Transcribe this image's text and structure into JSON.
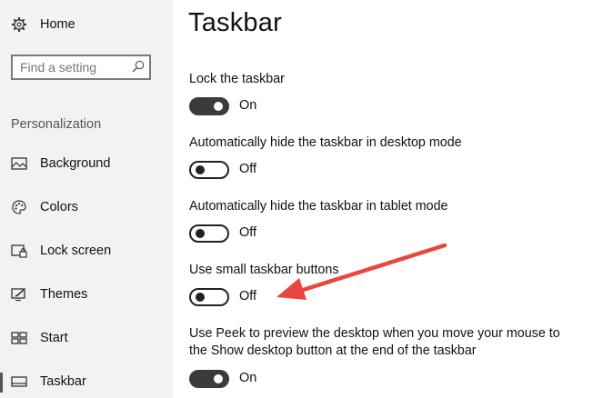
{
  "sidebar": {
    "home_label": "Home",
    "search": {
      "placeholder": "Find a setting"
    },
    "section_header": "Personalization",
    "items": [
      {
        "label": "Background",
        "icon": "image-icon"
      },
      {
        "label": "Colors",
        "icon": "palette-icon"
      },
      {
        "label": "Lock screen",
        "icon": "lock-screen-icon"
      },
      {
        "label": "Themes",
        "icon": "themes-icon"
      },
      {
        "label": "Start",
        "icon": "start-icon"
      },
      {
        "label": "Taskbar",
        "icon": "taskbar-icon",
        "active": true
      }
    ]
  },
  "main": {
    "title": "Taskbar",
    "settings": [
      {
        "label": "Lock the taskbar",
        "state": "On"
      },
      {
        "label": "Automatically hide the taskbar in desktop mode",
        "state": "Off"
      },
      {
        "label": "Automatically hide the taskbar in tablet mode",
        "state": "Off"
      },
      {
        "label": "Use small taskbar buttons",
        "state": "Off"
      },
      {
        "label_line1": "Use Peek to preview the desktop when you move your mouse to",
        "label_line2": "the Show desktop button at the end of the taskbar",
        "state": "On"
      }
    ]
  },
  "annotation": {
    "color": "#e8473f"
  },
  "colors": {
    "sidebar_bg": "#f2f2f2",
    "toggle_on": "#3b3b3b",
    "toggle_off_border": "#222222"
  }
}
